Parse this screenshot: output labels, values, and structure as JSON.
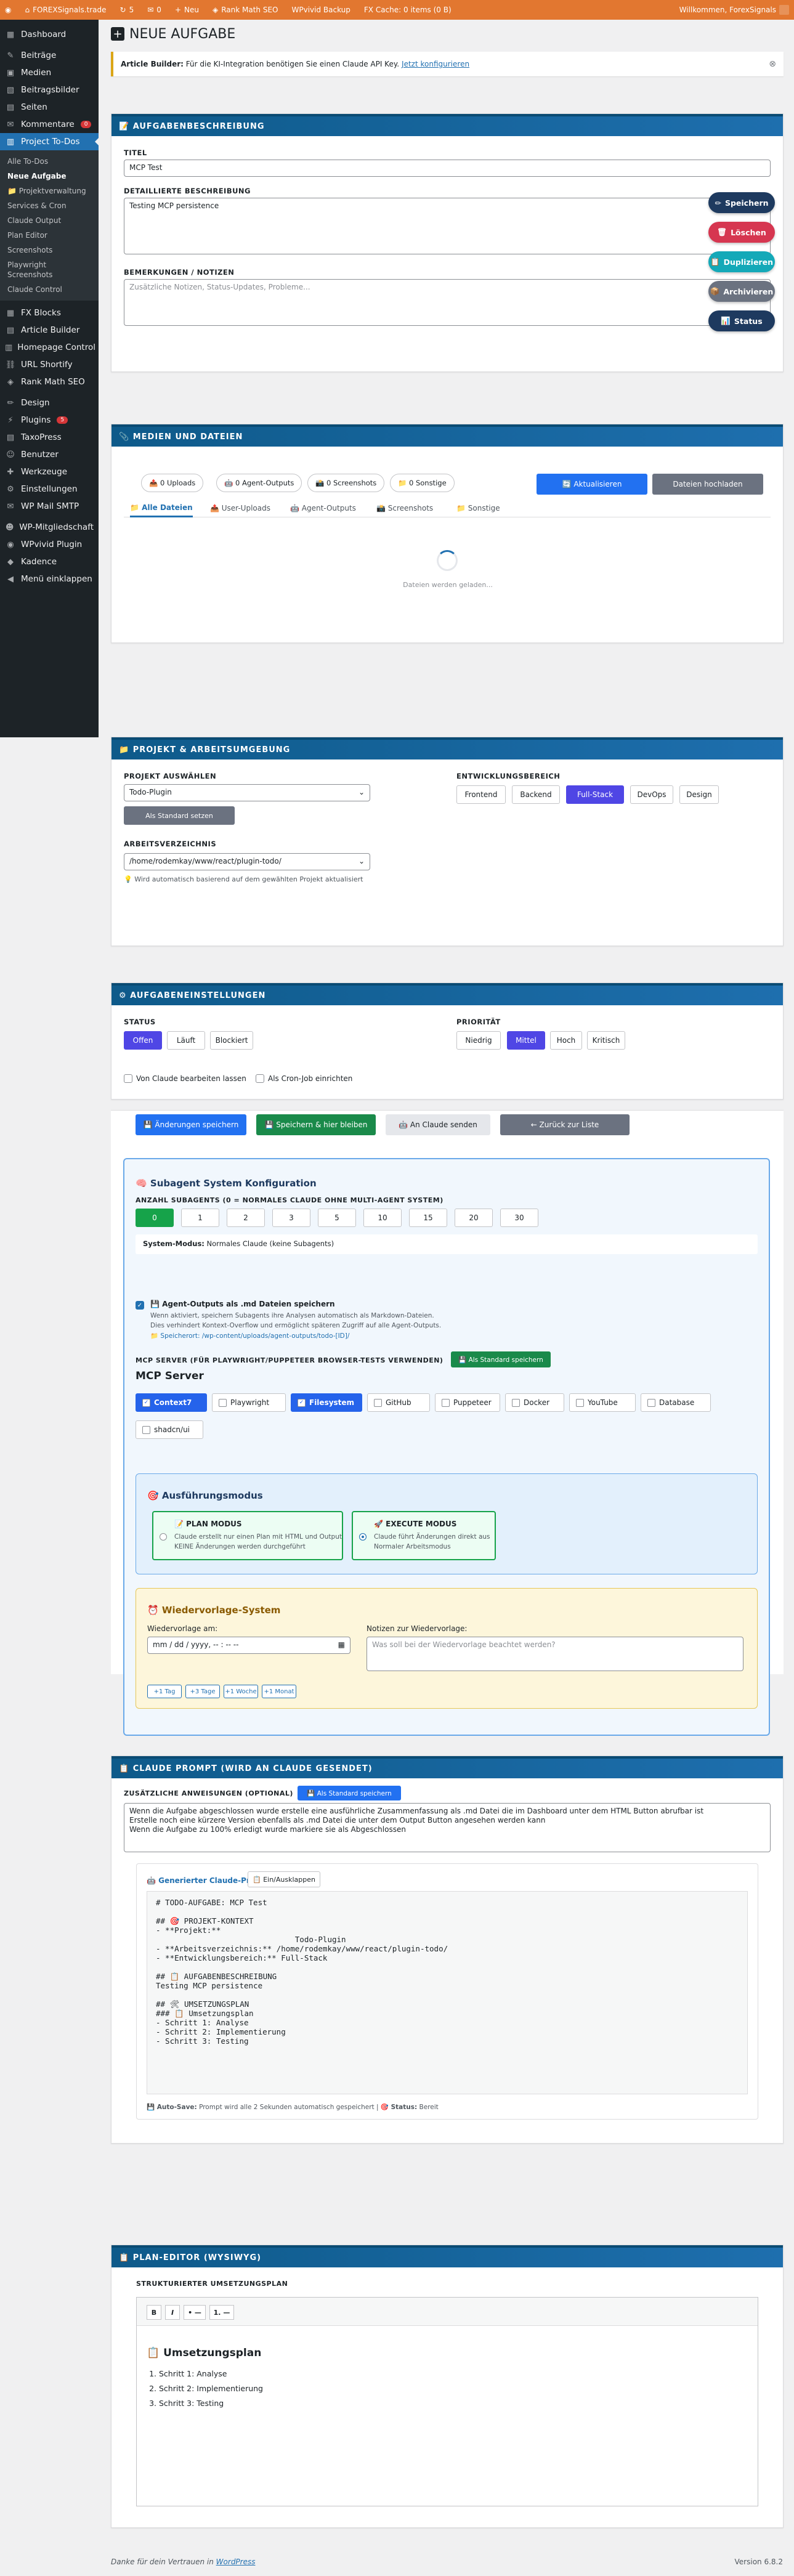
{
  "adminbar": {
    "site": "FOREXSignals.trade",
    "updates": "5",
    "comments": "0",
    "new": "Neu",
    "items": [
      "Rank Math SEO",
      "WPvivid Backup",
      "FX Cache: 0 items (0 B)"
    ],
    "greeting": "Willkommen, ForexSignals"
  },
  "sidebar": {
    "top": [
      {
        "icon": "dashboard-icon",
        "glyph": "▦",
        "label": "Dashboard"
      }
    ],
    "items": [
      {
        "icon": "pin-icon",
        "glyph": "✎",
        "label": "Beiträge"
      },
      {
        "icon": "media-icon",
        "glyph": "▣",
        "label": "Medien"
      },
      {
        "icon": "image-icon",
        "glyph": "▧",
        "label": "Beitragsbilder"
      },
      {
        "icon": "page-icon",
        "glyph": "▤",
        "label": "Seiten"
      },
      {
        "icon": "comment-icon",
        "glyph": "✉",
        "label": "Kommentare",
        "badge": "0"
      }
    ],
    "active": {
      "icon": "clipboard-icon",
      "glyph": "▥",
      "label": "Project To-Dos"
    },
    "submenu": [
      "Alle To-Dos",
      "Neue Aufgabe",
      "📁 Projektverwaltung",
      "Services & Cron",
      "Claude Output",
      "Plan Editor",
      "Screenshots",
      "Playwright Screenshots",
      "Claude Control"
    ],
    "items2": [
      {
        "icon": "blocks-icon",
        "glyph": "▦",
        "label": "FX Blocks"
      },
      {
        "icon": "article-icon",
        "glyph": "▤",
        "label": "Article Builder"
      },
      {
        "icon": "homepage-icon",
        "glyph": "▥",
        "label": "Homepage Control"
      },
      {
        "icon": "link-icon",
        "glyph": "⛓",
        "label": "URL Shortify"
      },
      {
        "icon": "rankmath-icon",
        "glyph": "◈",
        "label": "Rank Math SEO"
      }
    ],
    "items3": [
      {
        "icon": "brush-icon",
        "glyph": "✏",
        "label": "Design"
      },
      {
        "icon": "plugin-icon",
        "glyph": "⚡",
        "label": "Plugins",
        "badge": "5"
      },
      {
        "icon": "taxo-icon",
        "glyph": "▤",
        "label": "TaxoPress"
      },
      {
        "icon": "user-icon",
        "glyph": "☺",
        "label": "Benutzer"
      },
      {
        "icon": "wrench-icon",
        "glyph": "✚",
        "label": "Werkzeuge"
      },
      {
        "icon": "settings-icon",
        "glyph": "⚙",
        "label": "Einstellungen"
      },
      {
        "icon": "mail-icon",
        "glyph": "✉",
        "label": "WP Mail SMTP"
      }
    ],
    "items4": [
      {
        "icon": "members-icon",
        "glyph": "☻",
        "label": "WP-Mitgliedschaft"
      },
      {
        "icon": "wpvivid-icon",
        "glyph": "◉",
        "label": "WPvivid Plugin"
      },
      {
        "icon": "kadence-icon",
        "glyph": "◆",
        "label": "Kadence"
      },
      {
        "icon": "collapse-icon",
        "glyph": "◀",
        "label": "Menü einklappen"
      }
    ]
  },
  "page": {
    "title": "NEUE AUFGABE"
  },
  "notice": {
    "strong": "Article Builder:",
    "text": "Für die KI-Integration benötigen Sie einen Claude API Key.",
    "link": "Jetzt konfigurieren"
  },
  "desc": {
    "header": "📝 AUFGABENBESCHREIBUNG",
    "title_label": "TITEL",
    "title_value": "MCP Test",
    "detail_label": "DETAILLIERTE BESCHREIBUNG",
    "detail_value": "Testing MCP persistence",
    "notes_label": "BEMERKUNGEN / NOTIZEN",
    "notes_placeholder": "Zusätzliche Notizen, Status-Updates, Probleme..."
  },
  "fab": [
    {
      "name": "save",
      "glyph": "✏",
      "label": "Speichern",
      "color": "#1e3a5f"
    },
    {
      "name": "delete",
      "glyph": "🗑",
      "label": "Löschen",
      "color": "#d63650"
    },
    {
      "name": "duplicate",
      "glyph": "📋",
      "label": "Duplizieren",
      "color": "#14a9b8"
    },
    {
      "name": "archive",
      "glyph": "📦",
      "label": "Archivieren",
      "color": "#6b7280"
    },
    {
      "name": "status",
      "glyph": "📊",
      "label": "Status",
      "color": "#1e3a5f"
    }
  ],
  "media": {
    "header": "📎 MEDIEN UND DATEIEN",
    "chips": [
      "📤 0 Uploads",
      "🤖 0 Agent-Outputs",
      "📸 0 Screenshots",
      "📁 0 Sonstige"
    ],
    "refresh": "🔄 Aktualisieren",
    "upload": "Dateien hochladen",
    "tabs": [
      "📁 Alle Dateien",
      "📤 User-Uploads",
      "🤖 Agent-Outputs",
      "📸 Screenshots",
      "📁 Sonstige"
    ],
    "loading": "Dateien werden geladen..."
  },
  "project": {
    "header": "📁 PROJEKT & ARBEITSUMGEBUNG",
    "select_label": "PROJEKT AUSWÄHLEN",
    "select_value": "Todo-Plugin",
    "default_btn": "Als Standard setzen",
    "dir_label": "ARBEITSVERZEICHNIS",
    "dir_value": "/home/rodemkay/www/react/plugin-todo/",
    "dir_hint": "💡 Wird automatisch basierend auf dem gewählten Projekt aktualisiert",
    "area_label": "ENTWICKLUNGSBEREICH",
    "areas": [
      "Frontend",
      "Backend",
      "Full-Stack",
      "DevOps",
      "Design"
    ],
    "area_selected": 2
  },
  "settings": {
    "header": "⚙ AUFGABENEINSTELLUNGEN",
    "status_label": "STATUS",
    "status": [
      "Offen",
      "Läuft",
      "Blockiert"
    ],
    "priority_label": "PRIORITÄT",
    "priority": [
      "Niedrig",
      "Mittel",
      "Hoch",
      "Kritisch"
    ],
    "cb1": "Von Claude bearbeiten lassen",
    "cb2": "Als Cron-Job einrichten"
  },
  "actions": [
    "💾 Änderungen speichern",
    "💾 Speichern & hier bleiben",
    "🤖 An Claude senden",
    "← Zurück zur Liste"
  ],
  "subagent": {
    "title": "🧠 Subagent System Konfiguration",
    "count_label": "ANZAHL SUBAGENTS (0 = NORMALES CLAUDE OHNE MULTI-AGENT SYSTEM)",
    "counts": [
      "0",
      "1",
      "2",
      "3",
      "5",
      "10",
      "15",
      "20",
      "30"
    ],
    "mode_strong": "System-Modus:",
    "mode_text": "Normales Claude (keine Subagents)",
    "md_title": "💾 Agent-Outputs als .md Dateien speichern",
    "md_line1": "Wenn aktiviert, speichern Subagents ihre Analysen automatisch als Markdown-Dateien.",
    "md_line2": "Dies verhindert Kontext-Overflow und ermöglicht späteren Zugriff auf alle Agent-Outputs.",
    "md_line3": "📁 Speicherort: /wp-content/uploads/agent-outputs/todo-[ID]/",
    "mcp_label": "MCP SERVER (FÜR PLAYWRIGHT/PUPPETEER BROWSER-TESTS VERWENDEN)",
    "mcp_default": "💾 Als Standard speichern",
    "mcp_title": "MCP Server",
    "servers": [
      "Context7",
      "Playwright",
      "Filesystem",
      "GitHub",
      "Puppeteer",
      "Docker",
      "YouTube",
      "Database",
      "shadcn/ui"
    ],
    "servers_on": [
      0,
      2
    ],
    "exec_title": "🎯 Ausführungsmodus",
    "plan_title": "📝 PLAN MODUS",
    "plan_desc1": "Claude erstellt nur einen Plan mit HTML und Output",
    "plan_desc2": "KEINE Änderungen werden durchgeführt",
    "exec_mode_title": "🚀 EXECUTE MODUS",
    "exec_desc1": "Claude führt Änderungen direkt aus",
    "exec_desc2": "Normaler Arbeitsmodus",
    "wv_title": "⏰ Wiedervorlage-System",
    "wv_label": "Wiedervorlage am:",
    "wv_date": "mm / dd / yyyy, -- : -- --",
    "wv_notes_label": "Notizen zur Wiedervorlage:",
    "wv_notes_ph": "Was soll bei der Wiedervorlage beachtet werden?",
    "wv_quick": [
      "+1 Tag",
      "+3 Tage",
      "+1 Woche",
      "+1 Monat"
    ]
  },
  "prompt": {
    "header": "📋 CLAUDE PROMPT (WIRD AN CLAUDE GESENDET)",
    "extra_label": "ZUSÄTZLICHE ANWEISUNGEN (OPTIONAL)",
    "extra_btn": "💾 Als Standard speichern",
    "extra_lines": [
      "Wenn die Aufgabe abgeschlossen wurde erstelle eine ausführliche Zusammenfassung als .md Datei die im Dashboard unter dem HTML Button abrufbar ist",
      "Erstelle noch eine kürzere Version ebenfalls als .md Datei die unter dem Output Button angesehen werden kann",
      "Wenn die Aufgabe zu 100% erledigt wurde markiere sie als Abgeschlossen"
    ],
    "gen_title": "🤖 Generierter Claude-Prompt",
    "toggle": "📋 Ein/Ausklappen",
    "code": "# TODO-AUFGABE: MCP Test\n\n## 🎯 PROJEKT-KONTEXT\n- **Projekt:**\n                              Todo-Plugin\n- **Arbeitsverzeichnis:** /home/rodemkay/www/react/plugin-todo/\n- **Entwicklungsbereich:** Full-Stack\n\n## 📋 AUFGABENBESCHREIBUNG\nTesting MCP persistence\n\n## 🛠 UMSETZUNGSPLAN\n### 📋 Umsetzungsplan\n- Schritt 1: Analyse\n- Schritt 2: Implementierung\n- Schritt 3: Testing",
    "autosave_strong": "💾 Auto-Save:",
    "autosave_text": "Prompt wird alle 2 Sekunden automatisch gespeichert",
    "status_strong": "🎯 Status:",
    "status_text": "Bereit"
  },
  "plan": {
    "header": "📋 PLAN-EDITOR (WYSIWYG)",
    "label": "STRUKTURIERTER UMSETZUNGSPLAN",
    "tools": [
      "B",
      "I",
      "• —",
      "1. —"
    ],
    "title": "📋 Umsetzungsplan",
    "items": [
      "Schritt 1: Analyse",
      "Schritt 2: Implementierung",
      "Schritt 3: Testing"
    ]
  },
  "footer": {
    "thanks": "Danke für dein Vertrauen in",
    "link": "WordPress",
    "version": "Version 6.8.2"
  }
}
